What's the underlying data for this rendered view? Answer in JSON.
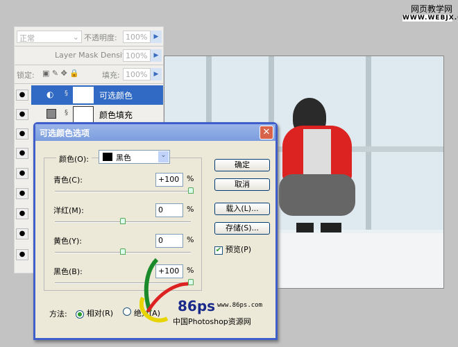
{
  "watermark_top": {
    "title": "网页教学网",
    "url": "WWW.WEBJX.COM"
  },
  "layers_panel": {
    "blend_mode": "正常",
    "opacity_label": "不透明度:",
    "opacity": "100%",
    "mask_density_label": "Layer Mask Density",
    "mask_density": "100%",
    "lock_label": "锁定:",
    "fill_label": "填充:",
    "fill": "100%",
    "layers": [
      {
        "name": "可选颜色",
        "selected": true
      },
      {
        "name": "颜色填充",
        "selected": false
      }
    ]
  },
  "dialog": {
    "title": "可选颜色选项",
    "color_label": "颜色(O):",
    "color_value": "黑色",
    "sliders": [
      {
        "label": "青色(C):",
        "value": "+100",
        "percent": 100
      },
      {
        "label": "洋红(M):",
        "value": "0",
        "percent": 50
      },
      {
        "label": "黄色(Y):",
        "value": "0",
        "percent": 50
      },
      {
        "label": "黑色(B):",
        "value": "+100",
        "percent": 100
      }
    ],
    "unit": "%",
    "buttons": {
      "ok": "确定",
      "cancel": "取消",
      "load": "载入(L)...",
      "save": "存储(S)..."
    },
    "preview_label": "预览(P)",
    "method_label": "方法:",
    "relative_label": "相对(R)",
    "absolute_label": "绝对(A)"
  },
  "logo": {
    "brand": "86ps",
    "url": "www.86ps.com",
    "tagline": "中国Photoshop资源网"
  }
}
